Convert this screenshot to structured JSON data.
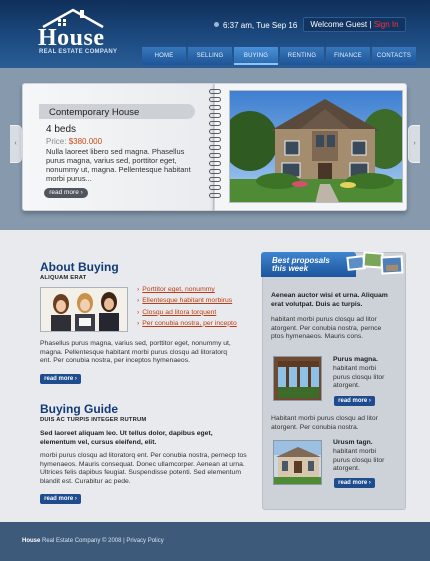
{
  "header": {
    "logo_word": "House",
    "logo_tagline": "REAL ESTATE COMPANY",
    "clock": "6:37 am, Tue Sep 16",
    "welcome": "Welcome Guest |",
    "sign_in": "Sign In",
    "nav": [
      "HOME",
      "SELLING",
      "BUYING",
      "RENTING",
      "FINANCE",
      "CONTACTS"
    ],
    "active_nav": "BUYING"
  },
  "banner": {
    "title": "Contemporary House",
    "beds": "4 beds",
    "price_label": "Price:",
    "price": "$380.000",
    "description": "Nulla laoreet libero sed magna. Phasellus purus magna, varius sed, porttitor eget, nonummy ut, magna. Pellentesque habitant morbi purus...",
    "read_more": "read more",
    "prev_arrow": "‹",
    "next_arrow": "›"
  },
  "about": {
    "title": "About Buying",
    "subtitle": "ALIQUAM ERAT",
    "links": [
      "Porttitor eget, nonummy",
      "Ellentesque habitant morbirus",
      "Closqu ad litora torquent",
      "Per conubia nostra, per incepto"
    ],
    "text": "Phasellus purus magna, varius sed, porttitor eget, nonummy ut, magna. Pellentesque habitant morbi purus closqu ad litoratorq ent. Per conubia nostra, per inceptos hymenaeos.",
    "read_more": "read more"
  },
  "guide": {
    "title": "Buying Guide",
    "subtitle": "DUIS AC TURPIS INTEGER RUTRUM",
    "bold_text": "Sed laoreet aliquam leo. Ut tellus dolor, dapibus eget, elementum vel, cursus eleifend, elit.",
    "text": "morbi purus closqu ad litoratorq ent. Per conubia nostra, pernecp tos hymenaeos. Mauris consequat. Donec ullamcorper. Aenean at urna. Ultrices felis dapibus feugiat. Suspendisse potenti. Sed elementum blandit est. Curabitur ac pede.",
    "read_more": "read more"
  },
  "proposals": {
    "title_line1": "Best proposals",
    "title_line2": "this week",
    "bold_text": "Aenean auctor wisi et urna. Aliquam erat volutpat. Duis ac turpis.",
    "text": "habitant morbi purus closqu ad litor atorgent. Per conubia nostra, pernce ptos hymenaeos. Mauris cons.",
    "card1": {
      "title": "Purus magna.",
      "text": "habitant morbi purus closqu litor atorgent.",
      "read_more": "read more"
    },
    "text2": "Habitant morbi purus closqu ad litor atorgent. Per conubia nostra.",
    "card2": {
      "title": "Urusm tagn.",
      "text": "habitant morbi purus closqu litor atorgent.",
      "read_more": "read more"
    }
  },
  "footer": {
    "brand": "House",
    "text": " Real Estate Company © 2008 | Privacy Policy"
  }
}
